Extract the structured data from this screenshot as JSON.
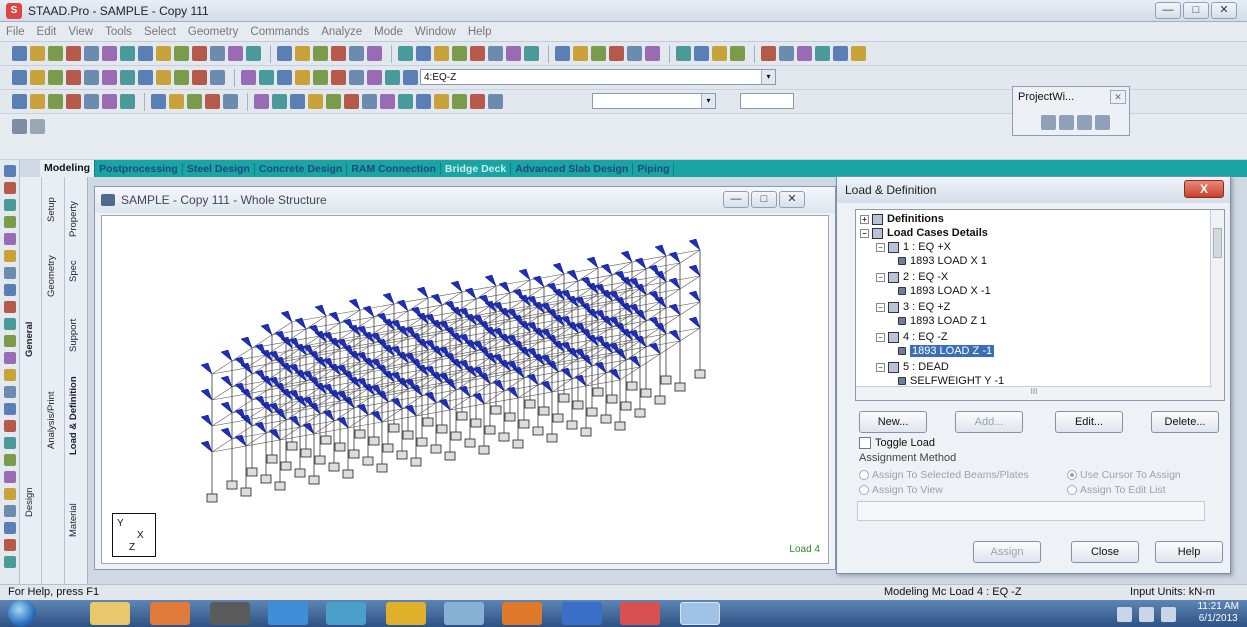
{
  "window": {
    "title": "STAAD.Pro - SAMPLE - Copy 111",
    "min": "—",
    "max": "□",
    "close": "✕"
  },
  "menu": [
    "File",
    "Edit",
    "View",
    "Tools",
    "Select",
    "Geometry",
    "Commands",
    "Analyze",
    "Mode",
    "Window",
    "Help"
  ],
  "toolbar": {
    "load_combo_value": "4:EQ-Z",
    "combo_arrow": "▾"
  },
  "project_window": {
    "title": "ProjectWi...",
    "close": "✕"
  },
  "mode_tabs": [
    "Modeling",
    "Postprocessing",
    "Steel Design",
    "Concrete Design",
    "RAM Connection",
    "Bridge Deck",
    "Advanced Slab Design",
    "Piping"
  ],
  "side_tabs": {
    "general": "General",
    "setup": "Setup",
    "geometry": "Geometry",
    "analysis_print": "Analysis/Print",
    "design": "Design",
    "property": "Property",
    "spec": "Spec",
    "support": "Support",
    "load_definition": "Load & Definition",
    "material": "Material"
  },
  "viewport_window": {
    "title": "SAMPLE - Copy 111 - Whole Structure",
    "min": "—",
    "max": "□",
    "close": "✕",
    "axis_y": "Y",
    "axis_x": "X",
    "axis_z": "Z",
    "load_label": "Load 4"
  },
  "dialog": {
    "title": "Load & Definition",
    "close": "X",
    "tree": {
      "expand_minus": "−",
      "expand_plus": "+",
      "definitions": "Definitions",
      "load_cases_details": "Load Cases Details",
      "cases": [
        {
          "label": "1 : EQ +X",
          "item": "1893 LOAD X 1"
        },
        {
          "label": "2 : EQ -X",
          "item": "1893 LOAD X -1"
        },
        {
          "label": "3 : EQ +Z",
          "item": "1893 LOAD Z 1"
        },
        {
          "label": "4 : EQ -Z",
          "item": "1893 LOAD Z -1"
        },
        {
          "label": "5 : DEAD",
          "item": "SELFWEIGHT Y -1"
        }
      ],
      "hscroll_label": "III"
    },
    "buttons": {
      "new": "New...",
      "add": "Add...",
      "edit": "Edit...",
      "delete": "Delete..."
    },
    "toggle_load": "Toggle Load",
    "assignment_method": "Assignment Method",
    "radios": {
      "assign_selected": "Assign To Selected Beams/Plates",
      "use_cursor": "Use Cursor To Assign",
      "assign_view": "Assign To View",
      "assign_edit_list": "Assign To Edit List"
    },
    "assign": "Assign",
    "close_btn": "Close",
    "help": "Help"
  },
  "status": {
    "help": "For Help, press F1",
    "mode": "Modeling Mc Load 4 : EQ -Z",
    "units": "Input Units: kN-m"
  },
  "taskbar": {
    "time": "11:21 AM",
    "date": "6/1/2013"
  }
}
